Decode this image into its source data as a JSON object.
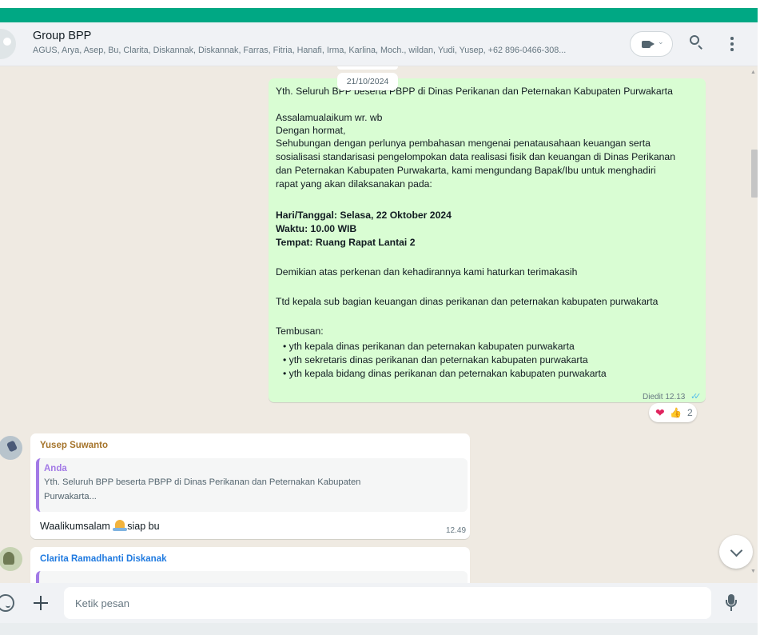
{
  "header": {
    "title": "Group BPP",
    "members": "AGUS, Arya, Asep, Bu, Clarita, Diskannak, Diskannak, Farras, Fitria, Hanafi, Irma, Karlina, Moch., wildan, Yudi, Yusep, +62 896-0466-308..."
  },
  "icons": {
    "video": "video-call-icon",
    "search": "search-icon",
    "menu": "menu-icon",
    "emoji": "emoji-icon",
    "attach": "plus-icon",
    "mic": "mic-icon",
    "scroll": "chevron-down-icon"
  },
  "chat": {
    "date_chip": "21/10/2024",
    "outgoing": {
      "lines": [
        "Yth. Seluruh BPP beserta PBPP di Dinas Perikanan dan Peternakan Kabupaten Purwakarta",
        "Assalamualaikum wr. wb",
        "Dengan hormat,",
        "Sehubungan dengan perlunya pembahasan mengenai penatausahaan keuangan serta",
        "sosialisasi standarisasi  pengelompokan data realisasi fisik dan keuangan di Dinas Perikanan",
        "dan Peternakan Kabupaten Purwakarta, kami mengundang Bapak/Ibu untuk menghadiri",
        "rapat yang akan dilaksanakan pada:",
        "Hari/Tanggal: Selasa, 22 Oktober 2024",
        "Waktu: 10.00 WIB",
        "Tempat: Ruang Rapat Lantai 2",
        "Demikian atas perkenan dan kehadirannya kami haturkan terimakasih",
        "Ttd kepala sub bagian keuangan dinas perikanan dan peternakan kabupaten purwakarta",
        "Tembusan:"
      ],
      "bullets": [
        "yth kepala dinas perikanan dan peternakan kabupaten purwakarta",
        "yth sekretaris dinas perikanan dan peternakan kabupaten purwakarta",
        "yth kepala bidang dinas perikanan dan peternakan kabupaten purwakarta"
      ],
      "meta": "Diedit 12.13",
      "ticks": "✓✓",
      "reaction_count": "2",
      "reactions": [
        "heart",
        "thumbs-up"
      ]
    },
    "incoming": [
      {
        "sender": "Yusep Suwanto",
        "quote_author": "Anda",
        "quote_lines": [
          "Yth. Seluruh BPP beserta PBPP di Dinas Perikanan dan Peternakan Kabupaten",
          "Purwakarta..."
        ],
        "text_before": "Waalikumsalam ",
        "text_after": "siap bu",
        "time": "12.49"
      },
      {
        "sender": "Clarita Ramadhanti Diskanak"
      }
    ]
  },
  "composer": {
    "placeholder": "Ketik pesan"
  },
  "colors": {
    "accent": "#00a884",
    "outgoing_bubble": "#d9fdd3",
    "chat_bg": "#efeae2",
    "read_ticks": "#53bdeb"
  }
}
